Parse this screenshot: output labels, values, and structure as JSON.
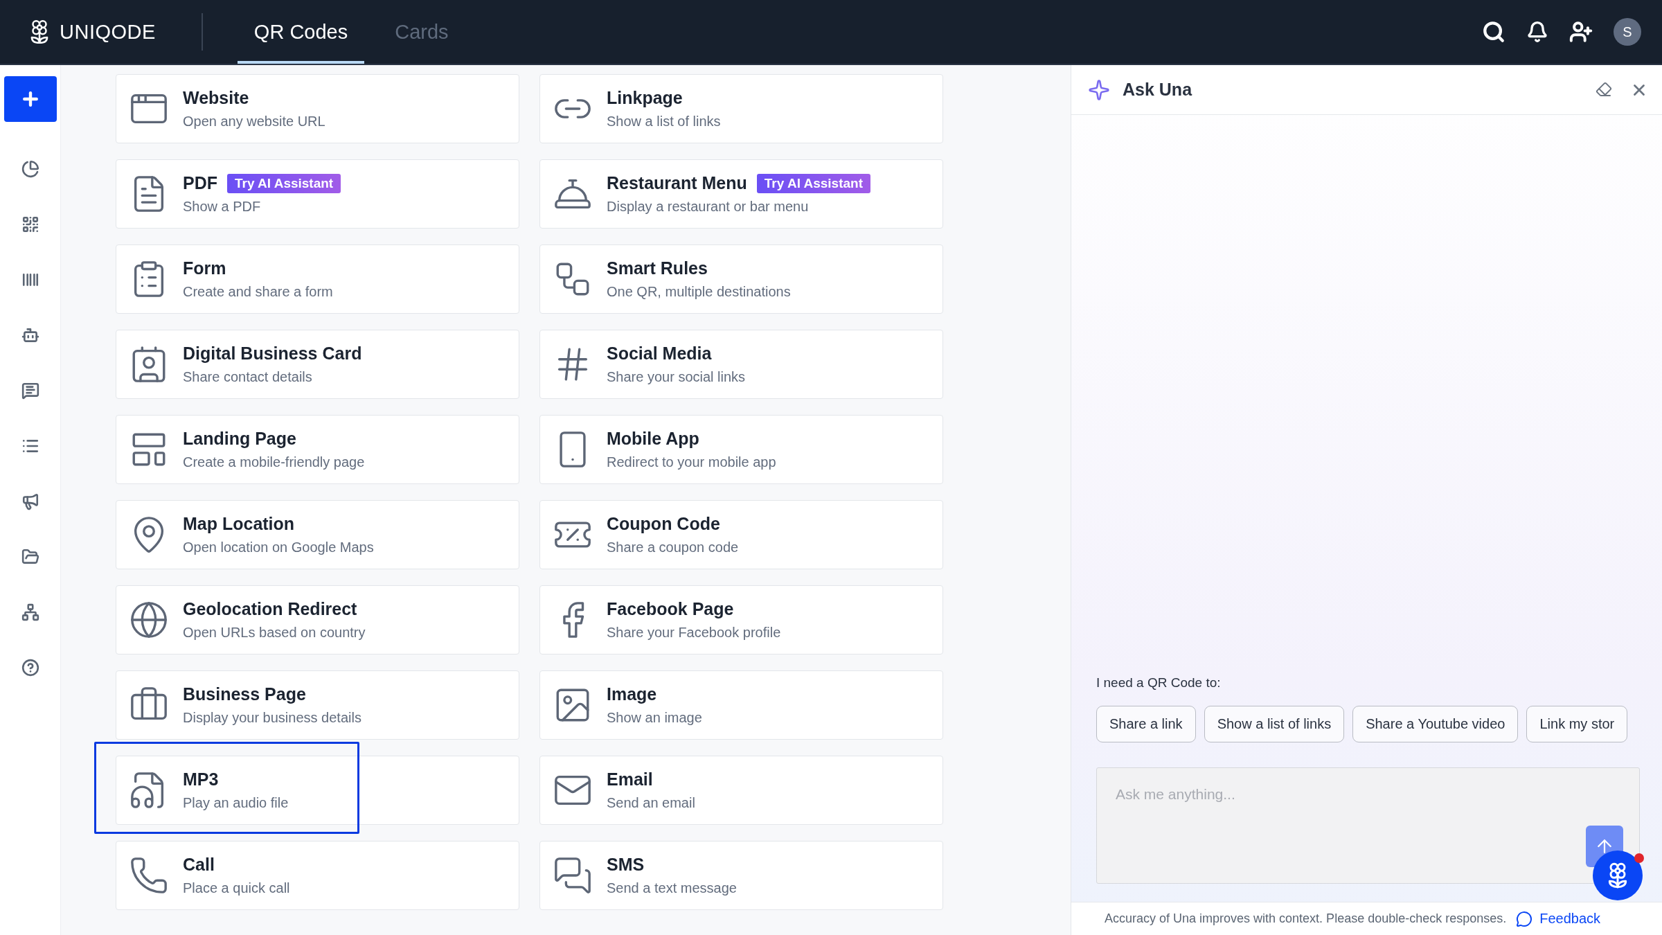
{
  "header": {
    "logo": "UNIQODE",
    "tabs": [
      {
        "label": "QR Codes",
        "selected": true
      },
      {
        "label": "Cards",
        "selected": false
      }
    ],
    "avatar": "S"
  },
  "qr_types": [
    {
      "title": "Website",
      "subtitle": "Open any website URL",
      "highlighted": false
    },
    {
      "title": "Linkpage",
      "subtitle": "Show a list of links",
      "highlighted": false
    },
    {
      "title": "PDF",
      "badge": "Try AI Assistant",
      "subtitle": "Show a PDF",
      "highlighted": false
    },
    {
      "title": "Restaurant Menu",
      "badge": "Try AI Assistant",
      "subtitle": "Display a restaurant or bar menu",
      "highlighted": false
    },
    {
      "title": "Form",
      "subtitle": "Create and share a form",
      "highlighted": false
    },
    {
      "title": "Smart Rules",
      "subtitle": "One QR, multiple destinations",
      "highlighted": false
    },
    {
      "title": "Digital Business Card",
      "subtitle": "Share contact details",
      "highlighted": false
    },
    {
      "title": "Social Media",
      "subtitle": "Share your social links",
      "highlighted": false
    },
    {
      "title": "Landing Page",
      "subtitle": "Create a mobile-friendly page",
      "highlighted": false
    },
    {
      "title": "Mobile App",
      "subtitle": "Redirect to your mobile app",
      "highlighted": false
    },
    {
      "title": "Map Location",
      "subtitle": "Open location on Google Maps",
      "highlighted": false
    },
    {
      "title": "Coupon Code",
      "subtitle": "Share a coupon code",
      "highlighted": false
    },
    {
      "title": "Geolocation Redirect",
      "subtitle": "Open URLs based on country",
      "highlighted": false
    },
    {
      "title": "Facebook Page",
      "subtitle": "Share your Facebook profile",
      "highlighted": false
    },
    {
      "title": "Business Page",
      "subtitle": "Display your business details",
      "highlighted": false
    },
    {
      "title": "Image",
      "subtitle": "Show an image",
      "highlighted": false
    },
    {
      "title": "MP3",
      "subtitle": "Play an audio file",
      "highlighted": true
    },
    {
      "title": "Email",
      "subtitle": "Send an email",
      "highlighted": false
    },
    {
      "title": "Call",
      "subtitle": "Place a quick call",
      "highlighted": false
    },
    {
      "title": "SMS",
      "subtitle": "Send a text message",
      "highlighted": false
    }
  ],
  "chat": {
    "title": "Ask Una",
    "prompt_label": "I need a QR Code to:",
    "suggestions": [
      "Share a link",
      "Show a list of links",
      "Share a Youtube video",
      "Link my stor"
    ],
    "input": {
      "placeholder": "Ask me anything..."
    },
    "disclaimer": "Accuracy of Una improves with context. Please double-check responses.",
    "feedback_link": "Feedback"
  }
}
